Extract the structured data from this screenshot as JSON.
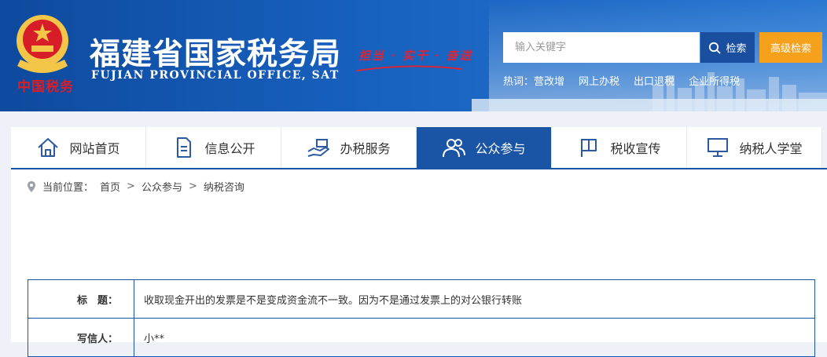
{
  "header": {
    "emblem_text": "中国税务",
    "title_cn": "福建省国家税务局",
    "title_en": "FUJIAN PROVINCIAL OFFICE, SAT",
    "slogan": "担当 · 实干 · 奋进"
  },
  "search": {
    "placeholder": "输入关键字",
    "button_label": "检索",
    "advanced_label": "高级检索"
  },
  "hotwords": {
    "label": "热词：",
    "items": [
      "营改增",
      "网上办税",
      "出口退税",
      "企业所得税"
    ]
  },
  "nav": {
    "items": [
      {
        "label": "网站首页",
        "icon": "home-icon"
      },
      {
        "label": "信息公开",
        "icon": "document-icon"
      },
      {
        "label": "办税服务",
        "icon": "service-icon"
      },
      {
        "label": "公众参与",
        "icon": "users-icon"
      },
      {
        "label": "税收宣传",
        "icon": "flag-icon"
      },
      {
        "label": "纳税人学堂",
        "icon": "monitor-icon"
      }
    ],
    "active_index": 3
  },
  "breadcrumb": {
    "prefix": "当前位置：",
    "items": [
      "首页",
      "公众参与",
      "纳税咨询"
    ],
    "separator": ">"
  },
  "detail": {
    "rows": [
      {
        "key": "标　题：",
        "value": "收取现金开出的发票是不是变成资金流不一致。因为不是通过发票上的对公银行转账"
      },
      {
        "key": "写信人：",
        "value": "小**"
      }
    ]
  },
  "colors": {
    "primary": "#1a54a5",
    "accent": "#f5a11c",
    "emblem_red": "#d71e28"
  }
}
